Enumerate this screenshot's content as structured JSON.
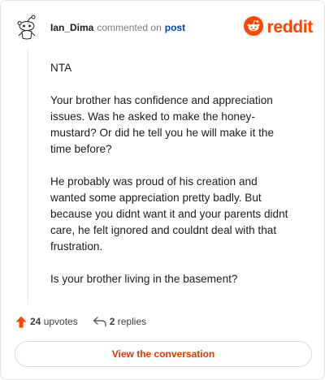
{
  "header": {
    "username": "Ian_Dima",
    "action_text": "commented on",
    "post_link": "post",
    "brand_name": "reddit"
  },
  "comment": {
    "paragraphs": [
      "NTA",
      "Your brother has confidence and appreciation issues. Was he asked to make the honey-mustard? Or did he tell you he will make it the time before?",
      "He probably was proud of his creation and wanted some appreciation pretty badly. But because you didnt want it and your parents didnt care, he felt ignored and couldnt deal with that frustration.",
      "Is your brother living in the basement?"
    ]
  },
  "stats": {
    "upvotes_count": "24",
    "upvotes_label": "upvotes",
    "replies_count": "2",
    "replies_label": "replies"
  },
  "cta": {
    "label": "View the conversation"
  },
  "colors": {
    "brand": "#ff4500",
    "link": "#0045ac",
    "cta_text": "#d93a00",
    "text": "#1c1c1c",
    "muted": "#7c7c7c"
  },
  "icons": [
    "snoo-avatar-icon",
    "reddit-logo-icon",
    "upvote-arrow-icon",
    "reply-arrow-icon"
  ]
}
